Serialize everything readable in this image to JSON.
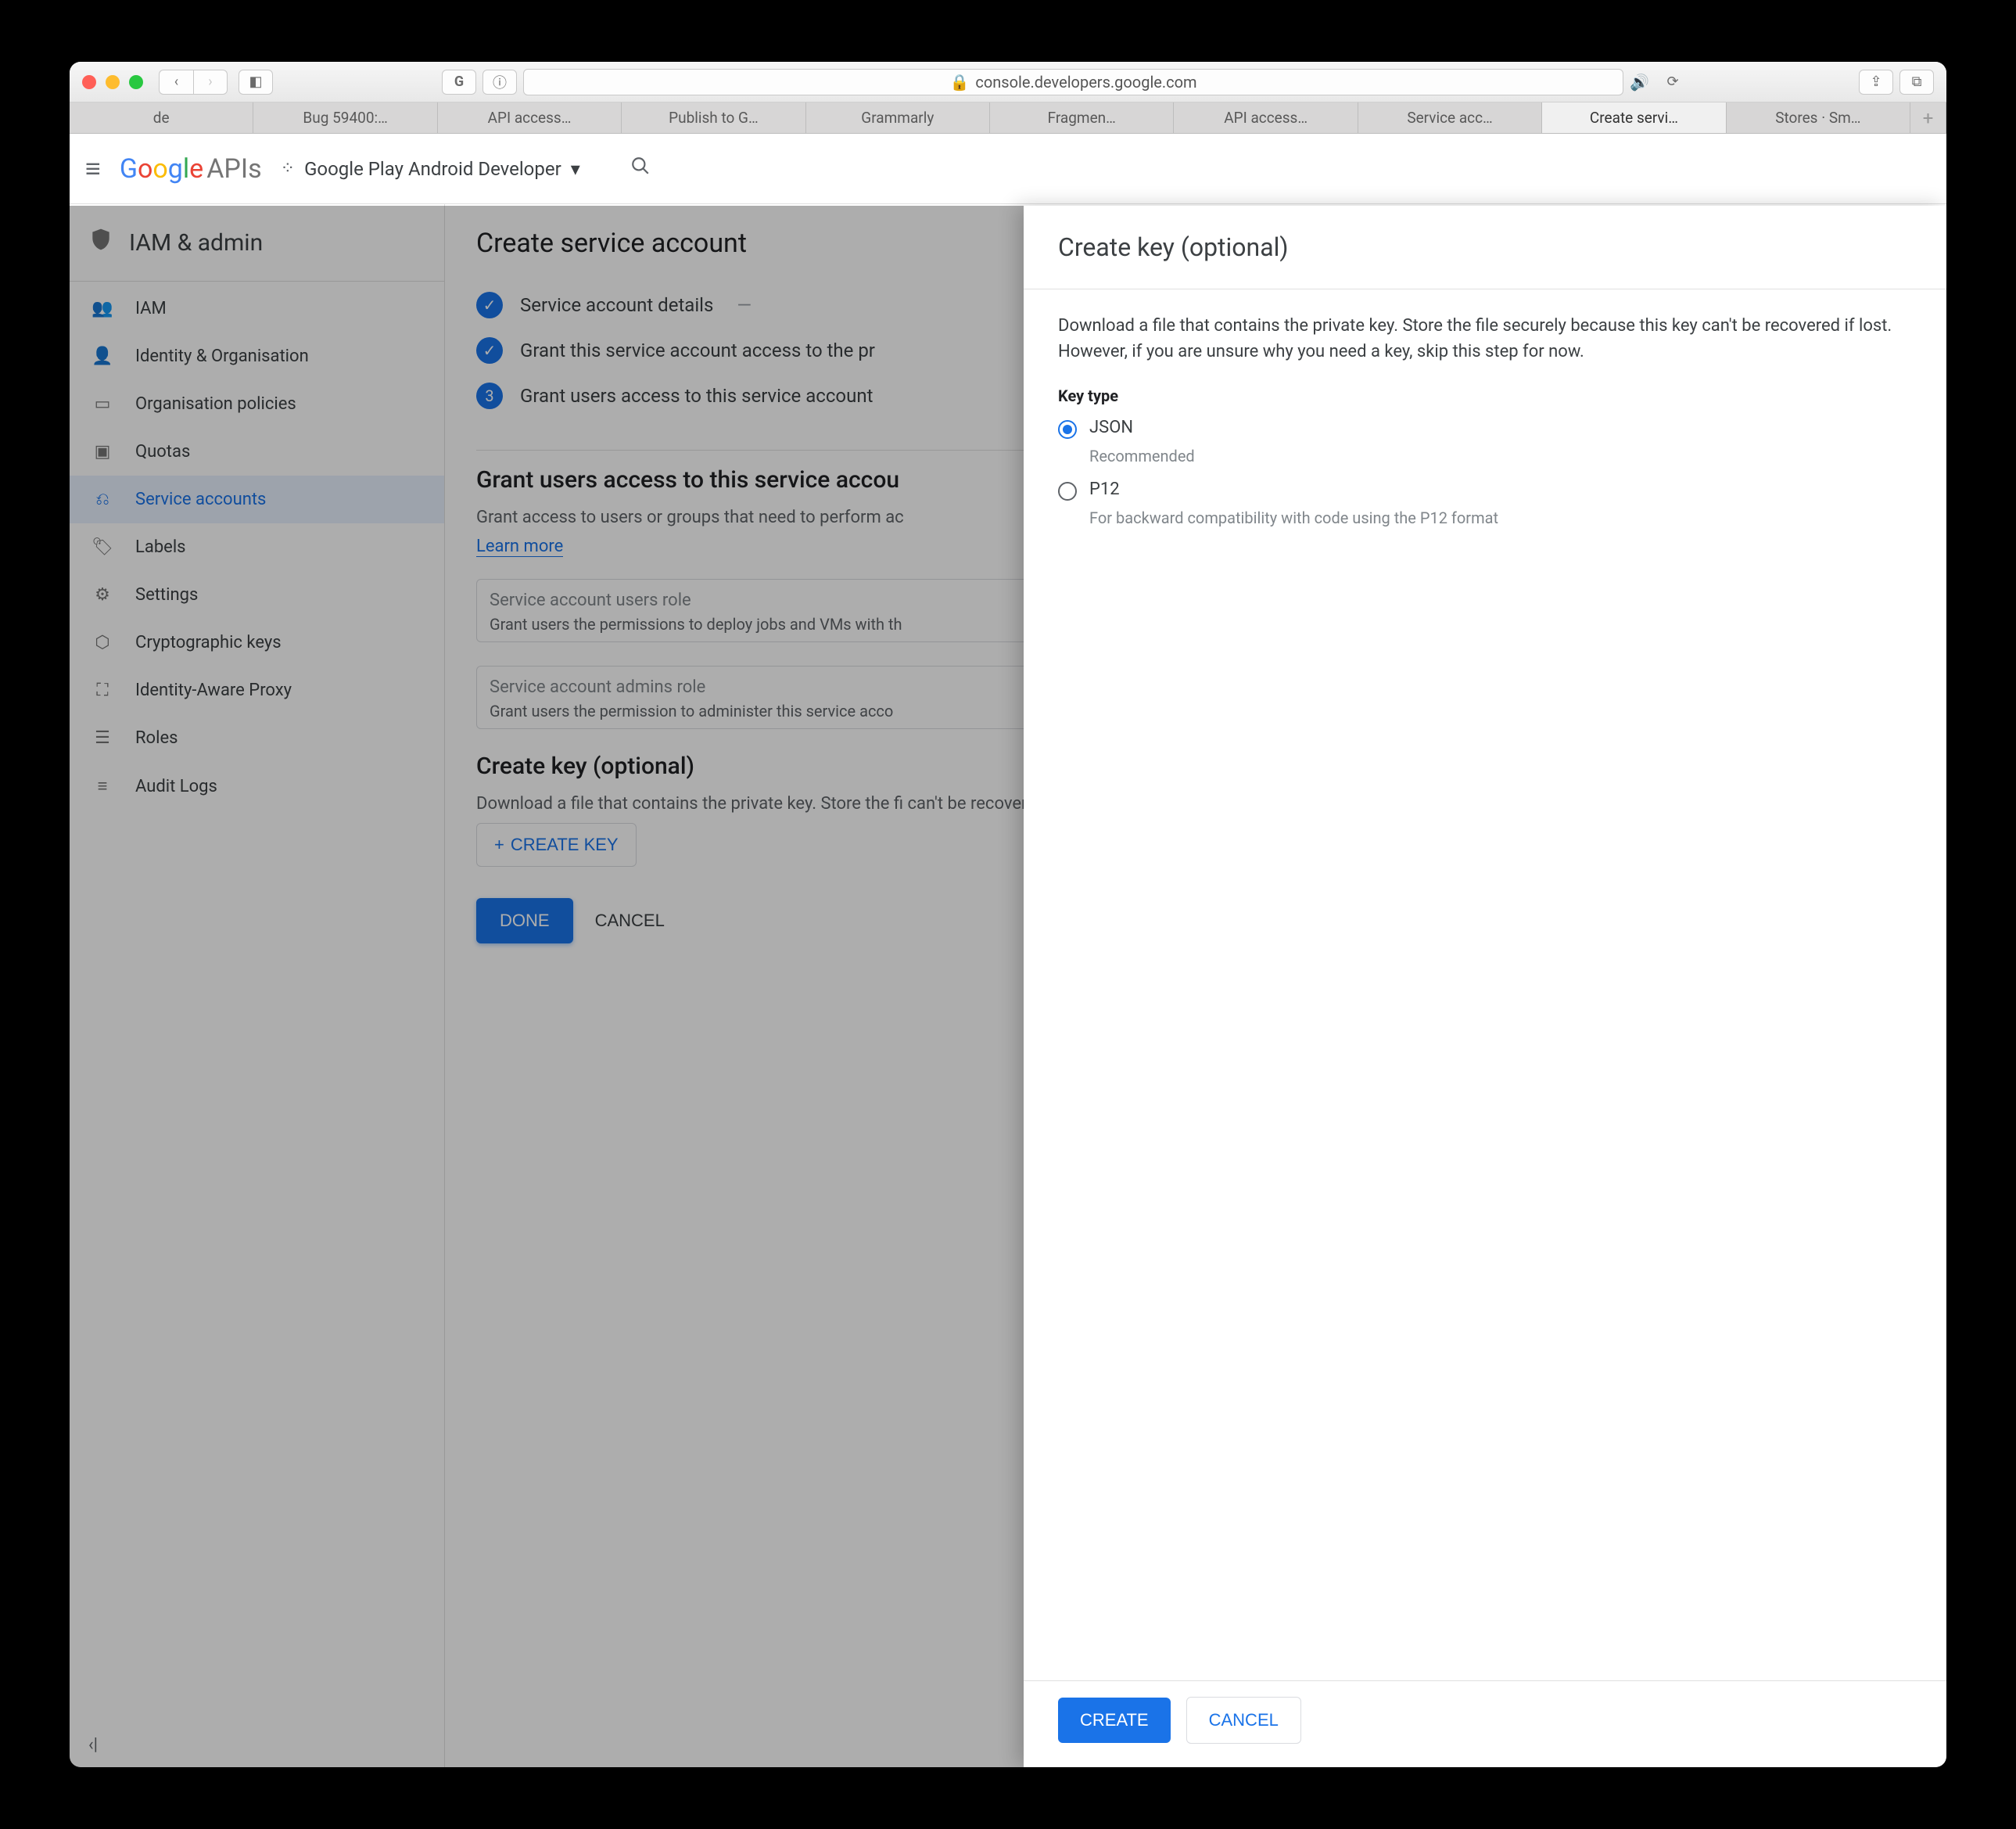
{
  "browser": {
    "url_host": "console.developers.google.com",
    "tabs": [
      {
        "label": "de"
      },
      {
        "label": "Bug 59400:…"
      },
      {
        "label": "API access…"
      },
      {
        "label": "Publish to G…"
      },
      {
        "label": "Grammarly"
      },
      {
        "label": "Fragmen…"
      },
      {
        "label": "API access…"
      },
      {
        "label": "Service acc…"
      },
      {
        "label": "Create servi…",
        "active": true
      },
      {
        "label": "Stores · Sm…"
      }
    ]
  },
  "appbar": {
    "logo_text": "Google",
    "logo_suffix": "APIs",
    "project_name": "Google Play Android Developer"
  },
  "sidebar": {
    "section_title": "IAM & admin",
    "items": [
      {
        "icon": "👥",
        "label": "IAM"
      },
      {
        "icon": "👤",
        "label": "Identity & Organisation"
      },
      {
        "icon": "▭",
        "label": "Organisation policies"
      },
      {
        "icon": "▣",
        "label": "Quotas"
      },
      {
        "icon": "⎌",
        "label": "Service accounts",
        "active": true
      },
      {
        "icon": "🏷",
        "label": "Labels"
      },
      {
        "icon": "⚙",
        "label": "Settings"
      },
      {
        "icon": "⬡",
        "label": "Cryptographic keys"
      },
      {
        "icon": "⛶",
        "label": "Identity-Aware Proxy"
      },
      {
        "icon": "☰",
        "label": "Roles"
      },
      {
        "icon": "≡",
        "label": "Audit Logs"
      }
    ]
  },
  "main": {
    "title": "Create service account",
    "steps": [
      {
        "state": "done",
        "label": "Service account details",
        "dash": true
      },
      {
        "state": "done",
        "label": "Grant this service account access to the pr"
      },
      {
        "state": "current",
        "num": "3",
        "label": "Grant users access to this service account"
      }
    ],
    "grant_heading": "Grant users access to this service accou",
    "grant_text": "Grant access to users or groups that need to perform ac",
    "learn_more": "Learn more",
    "field1_placeholder": "Service account users role",
    "field1_helper": "Grant users the permissions to deploy jobs and VMs with th",
    "field2_placeholder": "Service account admins role",
    "field2_helper": "Grant users the permission to administer this service acco",
    "create_key_heading": "Create key (optional)",
    "create_key_text": "Download a file that contains the private key. Store the fi can't be recovered if lost. However, if you are unsure why for now.",
    "create_key_btn": "CREATE KEY",
    "done_btn": "DONE",
    "cancel_btn": "CANCEL"
  },
  "drawer": {
    "title": "Create key (optional)",
    "body_text": "Download a file that contains the private key. Store the file securely because this key can't be recovered if lost. However, if you are unsure why you need a key, skip this step for now.",
    "key_type_label": "Key type",
    "options": [
      {
        "label": "JSON",
        "sub": "Recommended",
        "selected": true
      },
      {
        "label": "P12",
        "sub": "For backward compatibility with code using the P12 format",
        "selected": false
      }
    ],
    "create_btn": "CREATE",
    "cancel_btn": "CANCEL"
  }
}
